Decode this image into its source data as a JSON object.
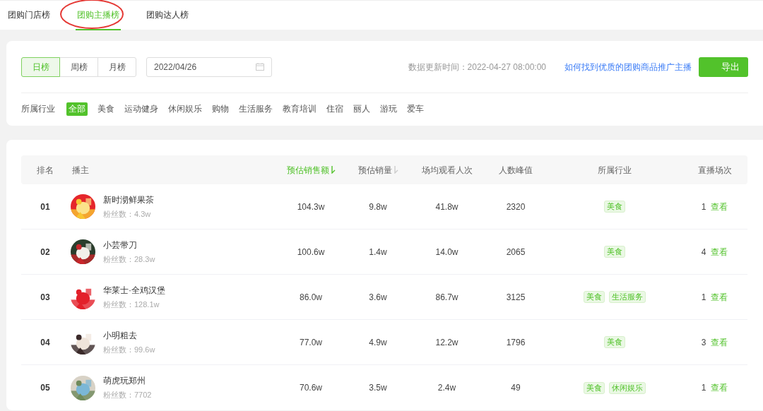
{
  "top_tabs": [
    {
      "label": "团购门店榜",
      "selected": false,
      "circled": false
    },
    {
      "label": "团购主播榜",
      "selected": true,
      "circled": true
    },
    {
      "label": "团购达人榜",
      "selected": false,
      "circled": false
    }
  ],
  "period_tabs": [
    {
      "label": "日榜",
      "selected": true
    },
    {
      "label": "周榜",
      "selected": false
    },
    {
      "label": "月榜",
      "selected": false
    }
  ],
  "date_field": {
    "value": "2022/04/26"
  },
  "update_time": "数据更新时间：2022-04-27 08:00:00",
  "help_link": "如何找到优质的团购商品推广主播",
  "export_button": "导出",
  "industry_filter": {
    "label": "所属行业",
    "options": [
      {
        "label": "全部",
        "selected": true
      },
      {
        "label": "美食",
        "selected": false
      },
      {
        "label": "运动健身",
        "selected": false
      },
      {
        "label": "休闲娱乐",
        "selected": false
      },
      {
        "label": "购物",
        "selected": false
      },
      {
        "label": "生活服务",
        "selected": false
      },
      {
        "label": "教育培训",
        "selected": false
      },
      {
        "label": "住宿",
        "selected": false
      },
      {
        "label": "丽人",
        "selected": false
      },
      {
        "label": "游玩",
        "selected": false
      },
      {
        "label": "爱车",
        "selected": false
      }
    ]
  },
  "table": {
    "columns": [
      {
        "label": "排名",
        "sort_arrow": false,
        "sorted": false
      },
      {
        "label": "播主",
        "sort_arrow": false,
        "sorted": false
      },
      {
        "label": "预估销售额",
        "sort_arrow": true,
        "sorted": true
      },
      {
        "label": "预估销量",
        "sort_arrow": true,
        "sorted": false
      },
      {
        "label": "场均观看人次",
        "sort_arrow": false,
        "sorted": false
      },
      {
        "label": "人数峰值",
        "sort_arrow": false,
        "sorted": false
      },
      {
        "label": "所属行业",
        "sort_arrow": false,
        "sorted": false
      },
      {
        "label": "直播场次",
        "sort_arrow": false,
        "sorted": false
      }
    ],
    "rows": [
      {
        "rank": "01",
        "name": "新时沏鲜果茶",
        "fans": "粉丝数：4.3w",
        "avatar": {
          "kind": "picture"
        },
        "sales": "104.3w",
        "volume": "9.8w",
        "views": "41.8w",
        "peak": "2320",
        "industries": [
          "美食"
        ],
        "sessions": "1",
        "action": "查看"
      },
      {
        "rank": "02",
        "name": "小芸带刀",
        "fans": "粉丝数：28.3w",
        "avatar": {
          "kind": "picture"
        },
        "sales": "100.6w",
        "volume": "1.4w",
        "views": "14.0w",
        "peak": "2065",
        "industries": [
          "美食"
        ],
        "sessions": "4",
        "action": "查看"
      },
      {
        "rank": "03",
        "name": "华莱士·全鸡汉堡",
        "fans": "粉丝数：128.1w",
        "avatar": {
          "kind": "picture"
        },
        "sales": "86.0w",
        "volume": "3.6w",
        "views": "86.7w",
        "peak": "3125",
        "industries": [
          "美食",
          "生活服务"
        ],
        "sessions": "1",
        "action": "查看"
      },
      {
        "rank": "04",
        "name": "小明粗去",
        "fans": "粉丝数：99.6w",
        "avatar": {
          "kind": "picture"
        },
        "sales": "77.0w",
        "volume": "4.9w",
        "views": "12.2w",
        "peak": "1796",
        "industries": [
          "美食"
        ],
        "sessions": "3",
        "action": "查看"
      },
      {
        "rank": "05",
        "name": "萌虎玩郑州",
        "fans": "粉丝数：7702",
        "avatar": {
          "kind": "picture"
        },
        "sales": "70.6w",
        "volume": "3.5w",
        "views": "2.4w",
        "peak": "49",
        "industries": [
          "美食",
          "休闲娱乐"
        ],
        "sessions": "1",
        "action": "查看"
      }
    ]
  }
}
